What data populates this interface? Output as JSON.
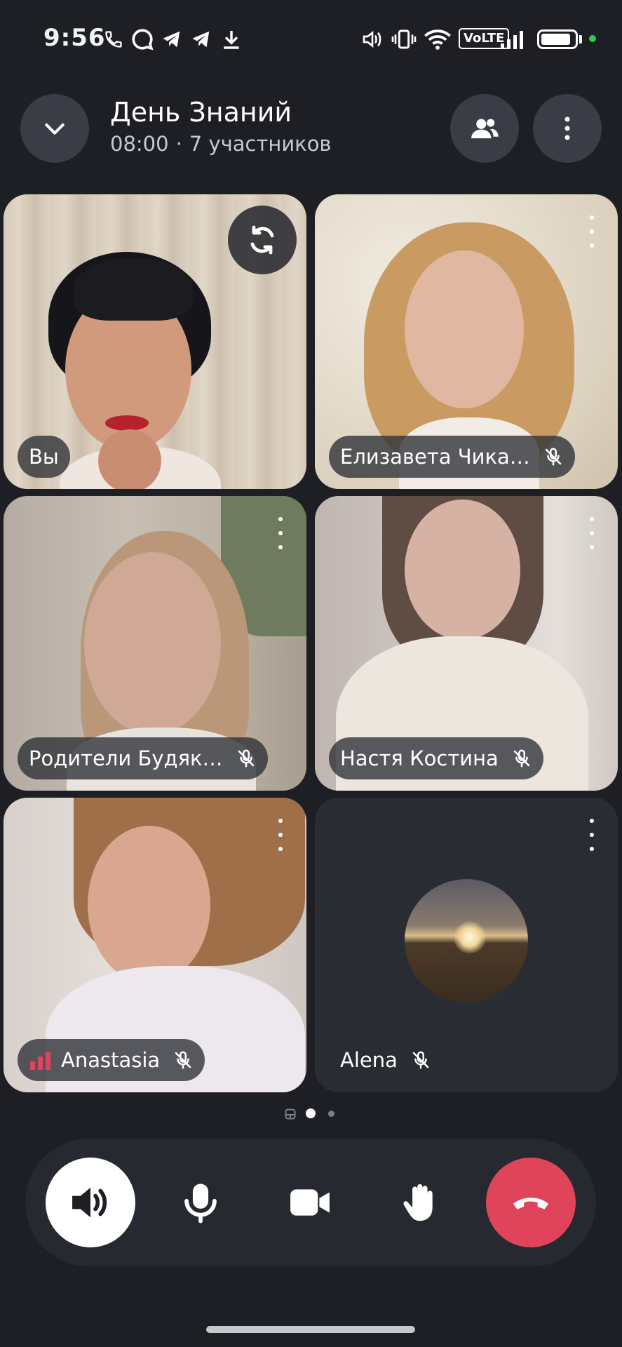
{
  "status_bar": {
    "time": "9:56",
    "left_icons": [
      "phone-icon",
      "chat-bubble-icon",
      "telegram-icon",
      "telegram-icon",
      "download-icon"
    ],
    "right_icons": [
      "speaker-icon",
      "vibrate-icon",
      "wifi-icon",
      "signal-icon",
      "battery-icon"
    ],
    "volte": "VoLTE",
    "battery_level": 0.9
  },
  "header": {
    "title": "День Знаний",
    "time": "08:00",
    "separator": "·",
    "participants": "7 участников"
  },
  "tiles": [
    {
      "name": "Вы",
      "muted": false,
      "video": true
    },
    {
      "name": "Елизавета Чика…",
      "muted": true,
      "video": true
    },
    {
      "name": "Родители Будяк…",
      "muted": true,
      "video": true
    },
    {
      "name": "Настя Костина",
      "muted": true,
      "video": true
    },
    {
      "name": "Anastasia",
      "muted": true,
      "video": true,
      "weak_signal": true
    },
    {
      "name": "Alena",
      "muted": true,
      "video": false,
      "avatar": "sunset-avatar"
    }
  ],
  "pager": {
    "pages": 3,
    "active": 1
  },
  "controls": [
    "speaker-button",
    "microphone-button",
    "camera-button",
    "raise-hand-button",
    "end-call-button"
  ],
  "colors": {
    "background": "#1d1f24",
    "end_call": "#e0445a",
    "weak_signal": "#e0445a"
  }
}
